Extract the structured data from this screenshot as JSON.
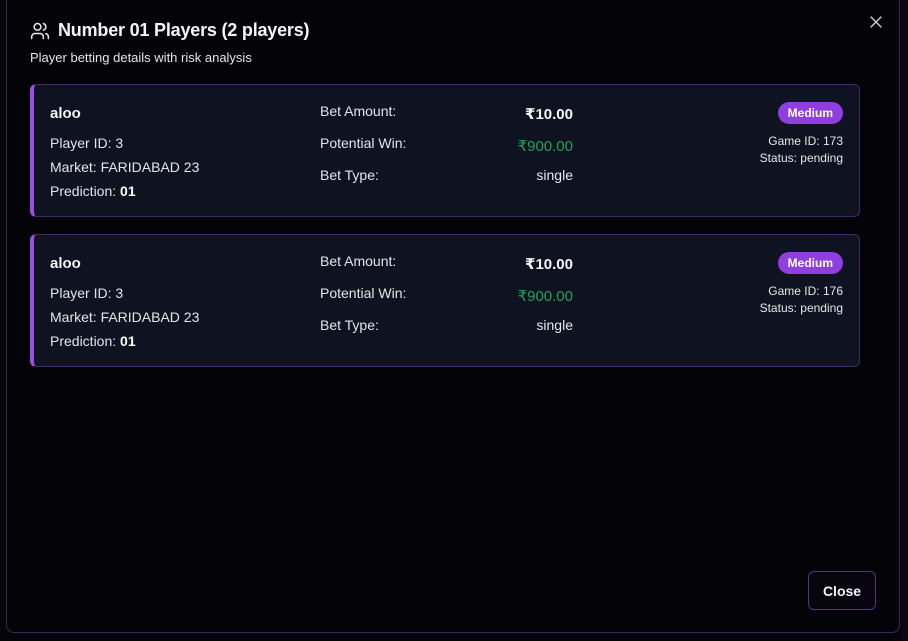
{
  "dialog": {
    "title": "Number 01 Players (2 players)",
    "subtitle": "Player betting details with risk analysis",
    "close_button_label": "Close",
    "icons": {
      "header": "users-icon",
      "close": "close-icon"
    }
  },
  "labels": {
    "bet_amount": "Bet Amount:",
    "potential_win": "Potential Win:",
    "bet_type": "Bet Type:",
    "player_id_prefix": "Player ID:",
    "market_prefix": "Market:",
    "prediction_prefix": "Prediction:"
  },
  "colors": {
    "accent": "#9b4fe0",
    "badge": "#8f3ee0",
    "win_green": "#1fa35a",
    "card_bg": "#0f1220"
  },
  "players": [
    {
      "name": "aloo",
      "player_id": "Player ID: 3",
      "market": "Market: FARIDABAD 23",
      "prediction_label": "Prediction:",
      "prediction_value": "01",
      "bet_amount": "₹10.00",
      "potential_win": "₹900.00",
      "bet_type": "single",
      "risk": "Medium",
      "game_id": "Game ID: 173",
      "status": "Status: pending"
    },
    {
      "name": "aloo",
      "player_id": "Player ID: 3",
      "market": "Market: FARIDABAD 23",
      "prediction_label": "Prediction:",
      "prediction_value": "01",
      "bet_amount": "₹10.00",
      "potential_win": "₹900.00",
      "bet_type": "single",
      "risk": "Medium",
      "game_id": "Game ID: 176",
      "status": "Status: pending"
    }
  ]
}
